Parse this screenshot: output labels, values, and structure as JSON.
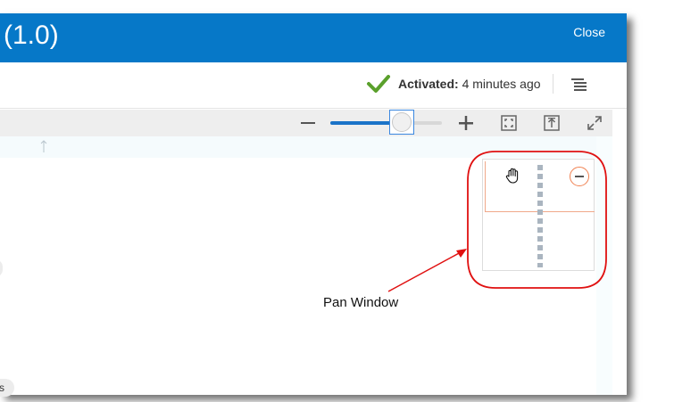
{
  "titlebar": {
    "title": "(1.0)",
    "close_label": "Close"
  },
  "status": {
    "activated_label": "Activated:",
    "activated_time": "4 minutes ago",
    "check_color": "#5aa02c"
  },
  "toolbar": {
    "zoom_out_icon": "minus-icon",
    "zoom_in_icon": "plus-icon",
    "zoom_level_fraction": 0.64,
    "fit_icon": "fit-to-screen-icon",
    "export_icon": "export-icon",
    "fullscreen_icon": "expand-icon"
  },
  "canvas": {
    "pill_right_text": "s"
  },
  "annotation": {
    "label": "Pan Window",
    "color": "#e01010"
  },
  "colors": {
    "brand": "#0678c8",
    "accent": "#1a73c8"
  }
}
